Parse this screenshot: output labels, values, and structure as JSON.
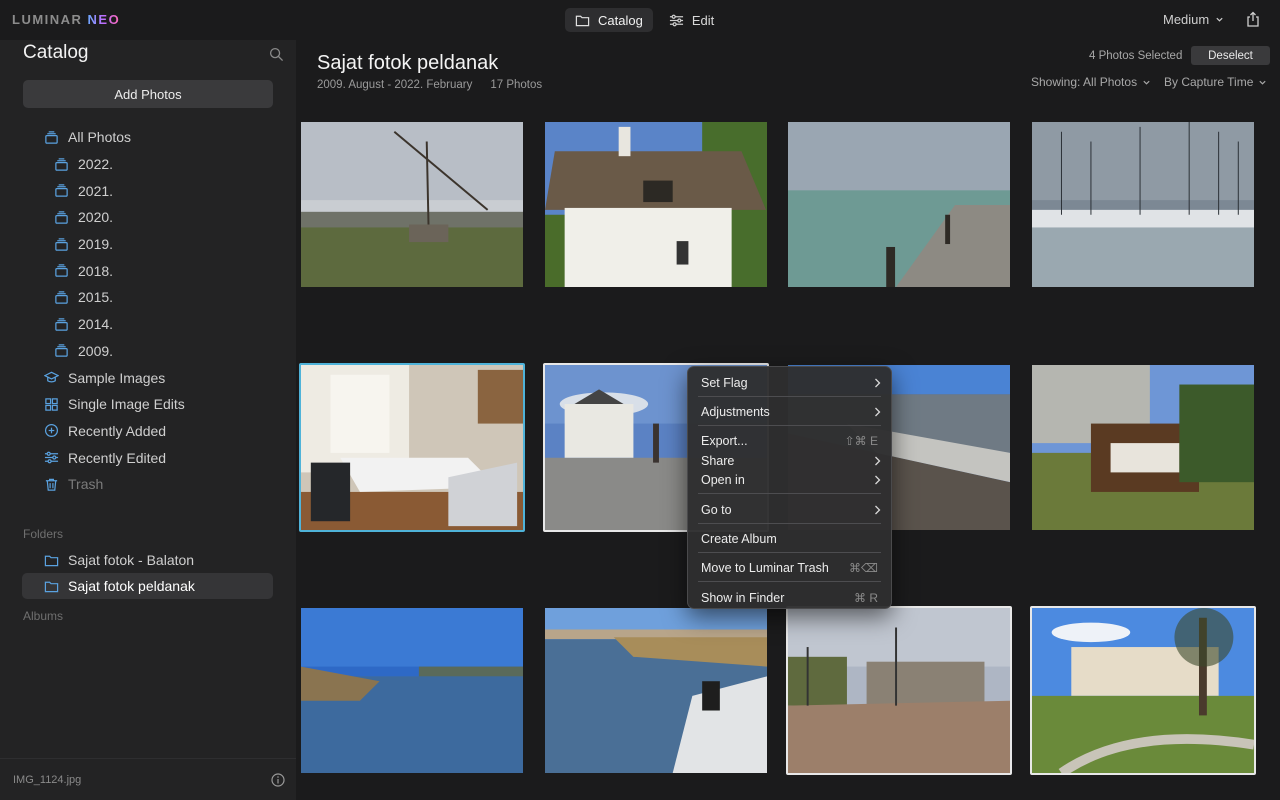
{
  "app": {
    "logo_main": "LUMINAR ",
    "logo_accent": "NEO"
  },
  "topbar": {
    "tabs": [
      {
        "label": "Catalog",
        "icon": "folder-icon",
        "active": true
      },
      {
        "label": "Edit",
        "icon": "sliders-icon",
        "active": false
      }
    ],
    "size": "Medium"
  },
  "sidebar": {
    "title": "Catalog",
    "add_photos": "Add Photos",
    "nav": [
      {
        "label": "All Photos",
        "icon": "stack-icon",
        "level": 0
      },
      {
        "label": "2022.",
        "icon": "stack-icon",
        "level": 1
      },
      {
        "label": "2021.",
        "icon": "stack-icon",
        "level": 1
      },
      {
        "label": "2020.",
        "icon": "stack-icon",
        "level": 1
      },
      {
        "label": "2019.",
        "icon": "stack-icon",
        "level": 1
      },
      {
        "label": "2018.",
        "icon": "stack-icon",
        "level": 1
      },
      {
        "label": "2015.",
        "icon": "stack-icon",
        "level": 1
      },
      {
        "label": "2014.",
        "icon": "stack-icon",
        "level": 1
      },
      {
        "label": "2009.",
        "icon": "stack-icon",
        "level": 1
      },
      {
        "label": "Sample Images",
        "icon": "graduation-cap-icon",
        "level": 0
      },
      {
        "label": "Single Image Edits",
        "icon": "grid-icon",
        "level": 0
      },
      {
        "label": "Recently Added",
        "icon": "plus-circle-icon",
        "level": 0
      },
      {
        "label": "Recently Edited",
        "icon": "sliders-icon",
        "level": 0
      },
      {
        "label": "Trash",
        "icon": "trash-icon",
        "level": 0,
        "dim": true
      }
    ],
    "folders_label": "Folders",
    "folders": [
      {
        "label": "Sajat fotok - Balaton",
        "active": false
      },
      {
        "label": "Sajat fotok peldanak",
        "active": true
      }
    ],
    "albums_label": "Albums",
    "footer_file": "IMG_1124.jpg"
  },
  "main": {
    "title": "Sajat fotok peldanak",
    "date_range": "2009. August - 2022. February",
    "photo_count": "17 Photos",
    "selected_count": "4 Photos Selected",
    "deselect": "Deselect",
    "showing": "Showing: All Photos",
    "sort": "By Capture Time"
  },
  "photos": [
    {
      "name": "well-sweep-landscape",
      "selected": ""
    },
    {
      "name": "thatched-cottage",
      "selected": ""
    },
    {
      "name": "lake-pier",
      "selected": ""
    },
    {
      "name": "marina-sailboats",
      "selected": ""
    },
    {
      "name": "office-interior",
      "selected": "blue"
    },
    {
      "name": "white-chapel",
      "selected": "white"
    },
    {
      "name": "lakeside-rocks",
      "selected": ""
    },
    {
      "name": "wooden-press",
      "selected": ""
    },
    {
      "name": "lake-reeds",
      "selected": ""
    },
    {
      "name": "shore-photographer",
      "selected": ""
    },
    {
      "name": "construction-street",
      "selected": "white"
    },
    {
      "name": "park-building",
      "selected": "white"
    }
  ],
  "context_menu": {
    "items": [
      {
        "label": "Set Flag",
        "submenu": true,
        "shortcut": ""
      },
      {
        "label": "Adjustments",
        "submenu": true,
        "shortcut": ""
      },
      {
        "label": "Export...",
        "submenu": false,
        "shortcut": "⇧⌘ E"
      },
      {
        "label": "Share",
        "submenu": true,
        "shortcut": ""
      },
      {
        "label": "Open in",
        "submenu": true,
        "shortcut": ""
      },
      {
        "label": "Go to",
        "submenu": true,
        "shortcut": ""
      },
      {
        "label": "Create Album",
        "submenu": false,
        "shortcut": ""
      },
      {
        "label": "Move to Luminar Trash",
        "submenu": false,
        "shortcut": "⌘⌫"
      },
      {
        "label": "Show in Finder",
        "submenu": false,
        "shortcut": "⌘ R"
      }
    ]
  },
  "colors": {
    "accent_blue": "#4fb3d9",
    "sidebar_icon": "#5aa2e0",
    "panel": "#232324"
  }
}
